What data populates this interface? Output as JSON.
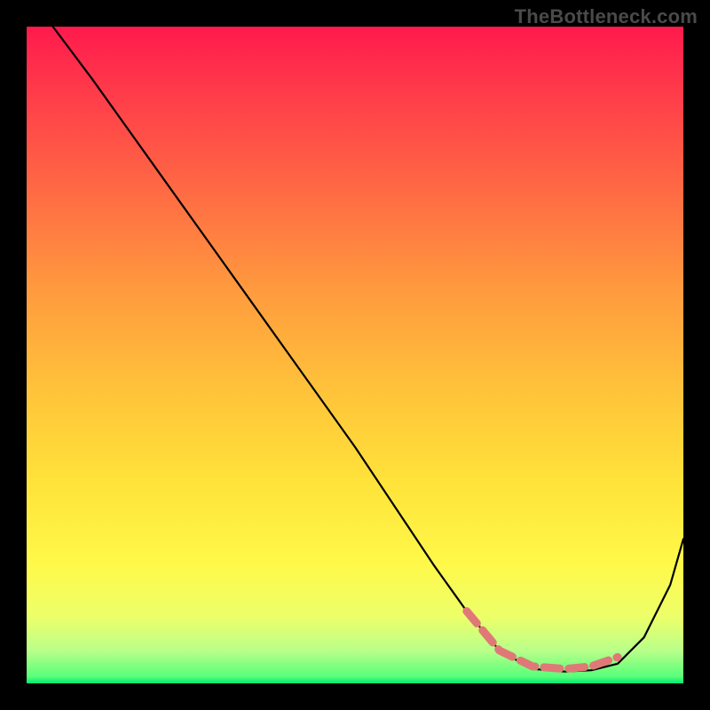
{
  "watermark": "TheBottleneck.com",
  "chart_data": {
    "type": "line",
    "title": "",
    "xlabel": "",
    "ylabel": "",
    "xlim": [
      0,
      100
    ],
    "ylim": [
      0,
      100
    ],
    "grid": false,
    "series": [
      {
        "name": "bottleneck-curve",
        "x": [
          4,
          10,
          20,
          30,
          40,
          50,
          58,
          62,
          67,
          72,
          77,
          82,
          86,
          90,
          94,
          98,
          100
        ],
        "y": [
          100,
          92,
          78,
          64,
          50,
          36,
          24,
          18,
          11,
          5,
          2.2,
          1.8,
          2.0,
          3.0,
          7,
          15,
          22
        ]
      }
    ],
    "annotations": [
      {
        "name": "optimal-range-marker",
        "style": "dashed-pink",
        "x": [
          67,
          72,
          77,
          82,
          86,
          90
        ],
        "y": [
          11,
          5,
          2.6,
          2.2,
          2.6,
          4.0
        ]
      }
    ]
  }
}
